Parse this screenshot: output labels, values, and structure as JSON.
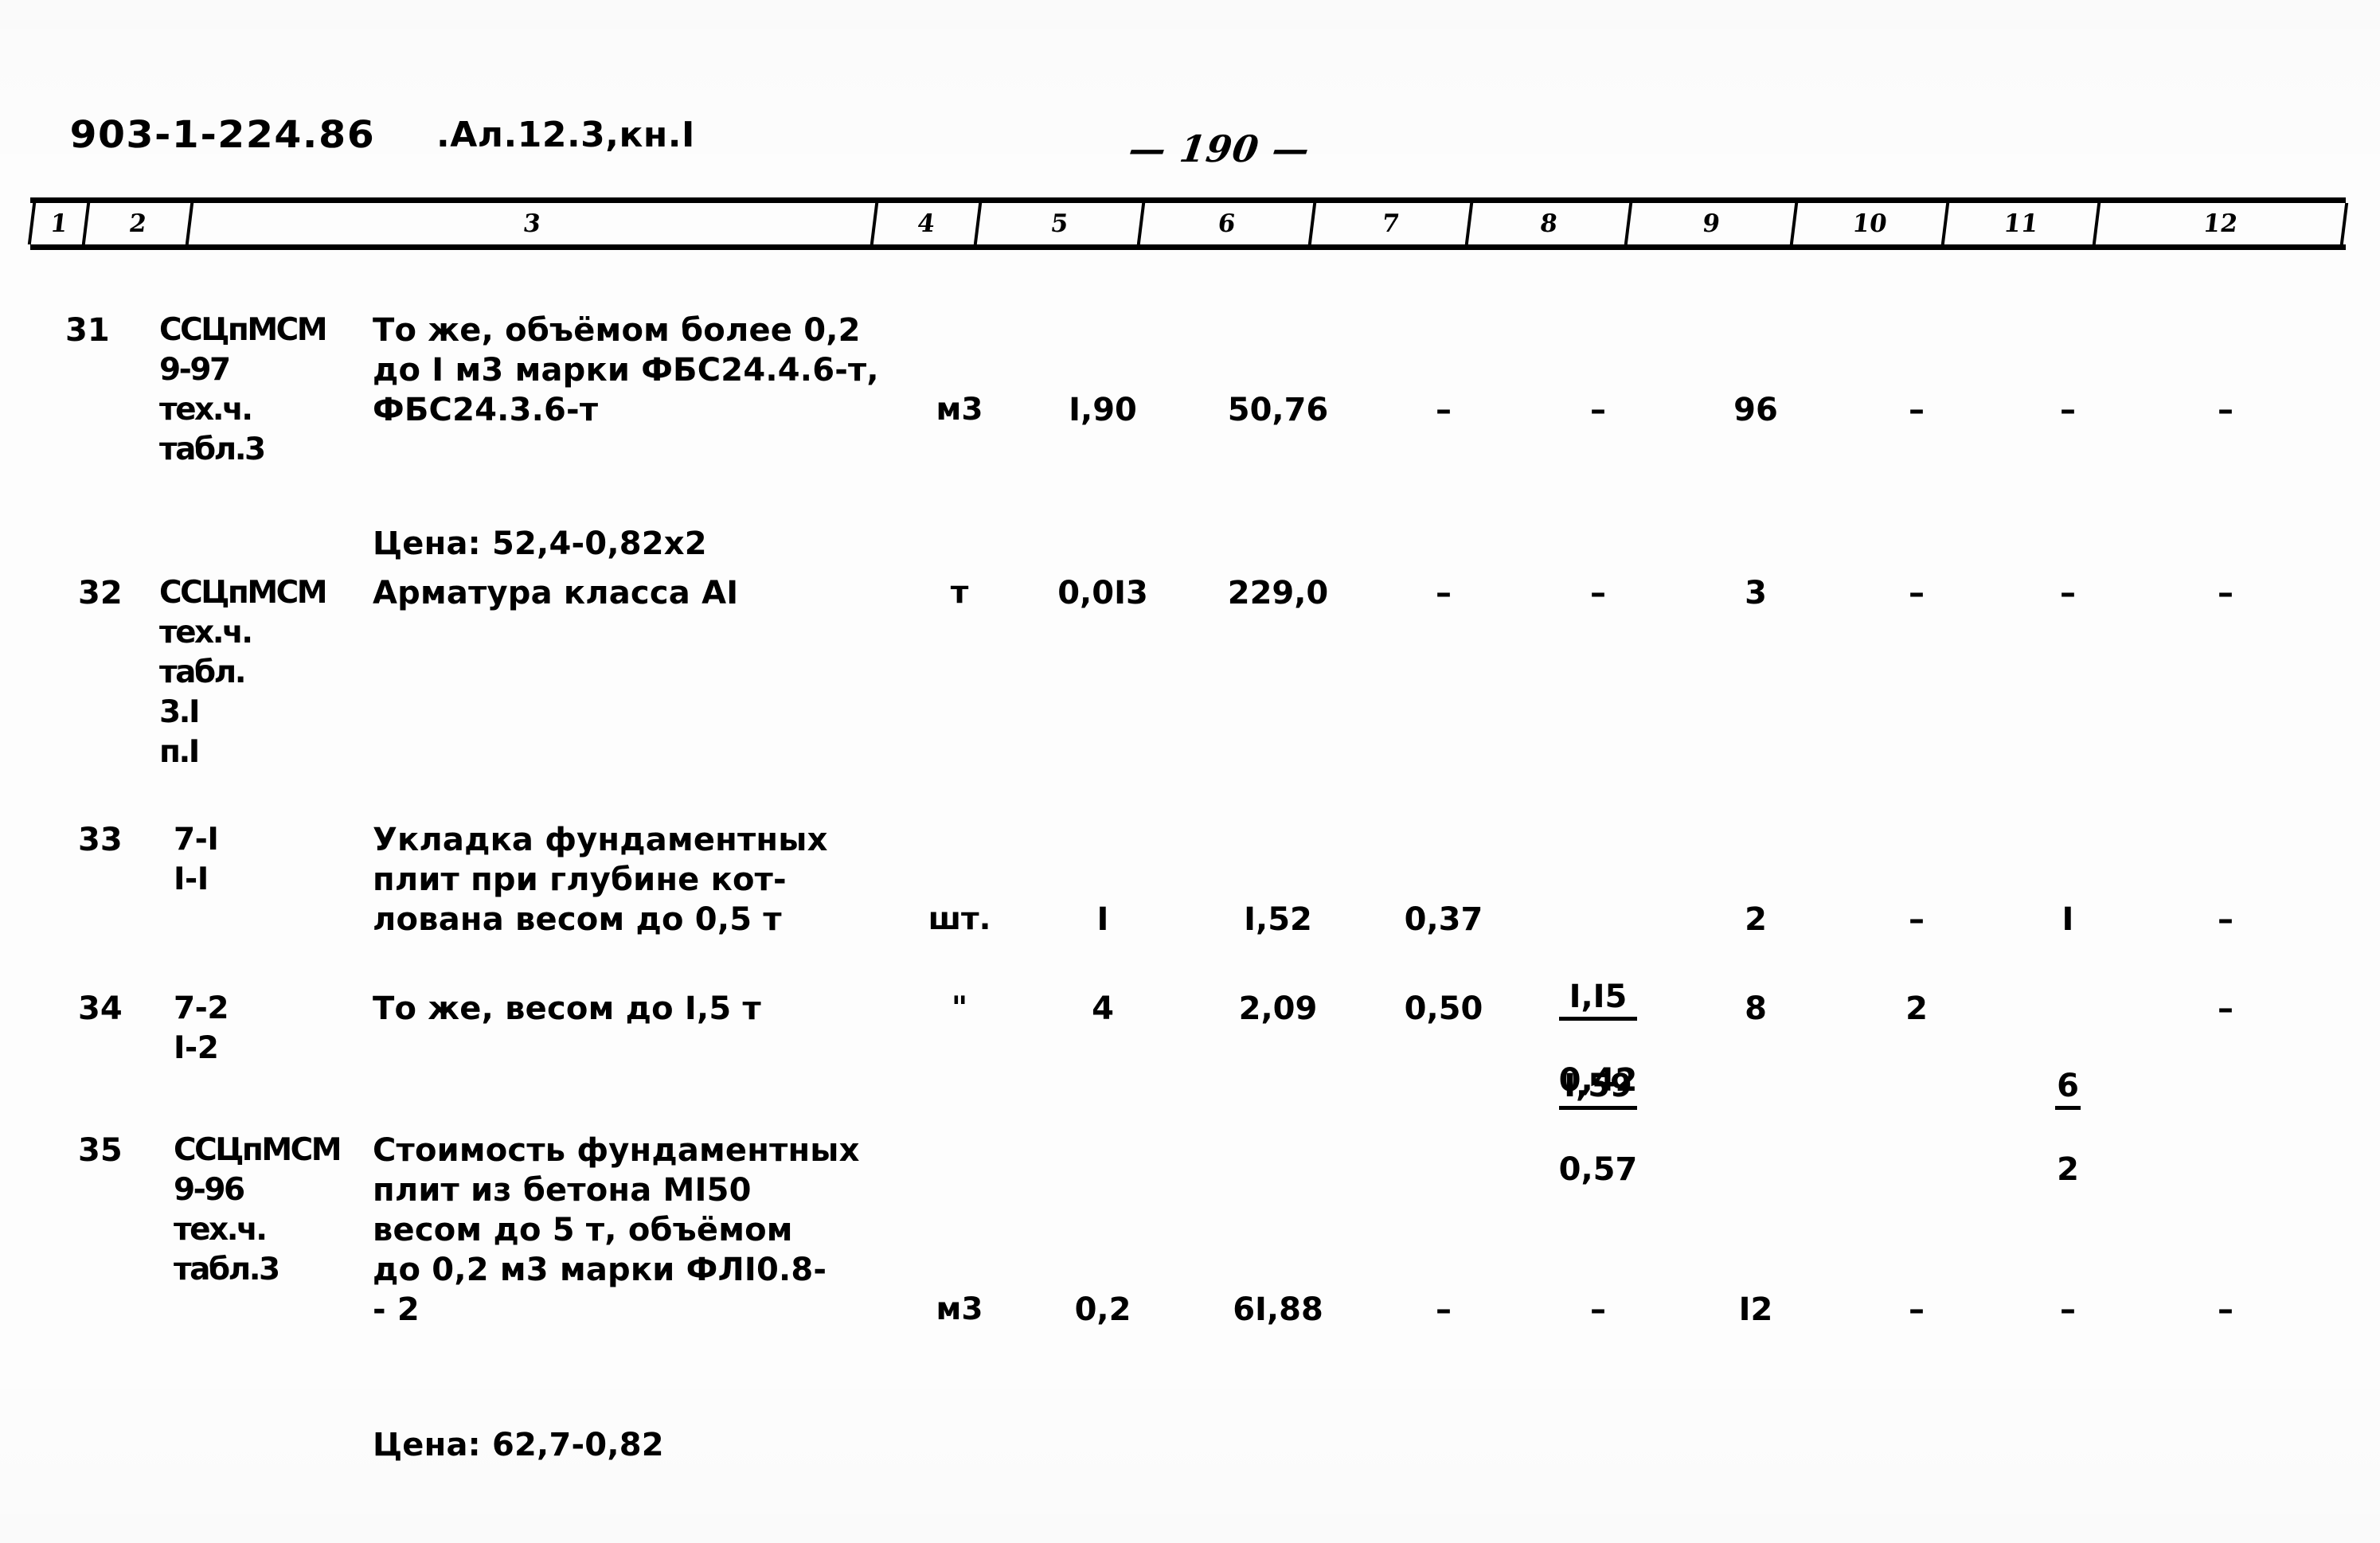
{
  "header": {
    "doc_code": "903-1-224.86",
    "album": ".Ал.12.3,кн.I",
    "page_number": "— 190 —"
  },
  "table": {
    "column_numbers": [
      "1",
      "2",
      "3",
      "4",
      "5",
      "6",
      "7",
      "8",
      "9",
      "10",
      "11",
      "12"
    ],
    "rows": [
      {
        "num": "31",
        "code": "ССЦпМСМ\n9-97\nтех.ч.\nтабл.3",
        "description": "То же, объёмом более 0,2\nдо I м3 марки ФБС24.4.6-т,\nФБС24.3.6-т",
        "unit": "м3",
        "c5": "I,90",
        "c6": "50,76",
        "c7": "–",
        "c8": "–",
        "c9": "96",
        "c10": "–",
        "c11": "–",
        "c12": "–",
        "note": "Цена: 52,4-0,82x2"
      },
      {
        "num": "32",
        "code": "ССЦпМСМ\nтех.ч.\nтабл.\n3.I\nп.I",
        "description": "Арматура класса AI",
        "unit": "т",
        "c5": "0,0I3",
        "c6": "229,0",
        "c7": "–",
        "c8": "–",
        "c9": "3",
        "c10": "–",
        "c11": "–",
        "c12": "–",
        "note": ""
      },
      {
        "num": "33",
        "code": "7-I\nI-I",
        "description": "Укладка фундаментных\nплит при глубине кот-\nлована весом до 0,5 т",
        "unit": "шт.",
        "c5": "I",
        "c6": "I,52",
        "c7": "0,37",
        "c8_num": "I,I5",
        "c8_den": "0,42",
        "c9": "2",
        "c10": "–",
        "c11": "I",
        "c12": "–",
        "note": ""
      },
      {
        "num": "34",
        "code": "7-2\nI-2",
        "description": "То же, весом до I,5 т",
        "unit": "\"",
        "c5": "4",
        "c6": "2,09",
        "c7": "0,50",
        "c8_num": "I,59",
        "c8_den": "0,57",
        "c9": "8",
        "c10": "2",
        "c11_num": "6",
        "c11_den": "2",
        "c12": "–",
        "note": ""
      },
      {
        "num": "35",
        "code": "ССЦпМСМ\n9-96\nтех.ч.\nтабл.3",
        "description": "Стоимость фундаментных\nплит из бетона МI50\nвесом до 5 т, объёмом\nдо 0,2 м3 марки ФЛI0.8-\n- 2",
        "unit": "м3",
        "c5": "0,2",
        "c6": "6I,88",
        "c7": "–",
        "c8": "–",
        "c9": "I2",
        "c10": "–",
        "c11": "–",
        "c12": "–",
        "note": "Цена: 62,7-0,82"
      }
    ]
  }
}
